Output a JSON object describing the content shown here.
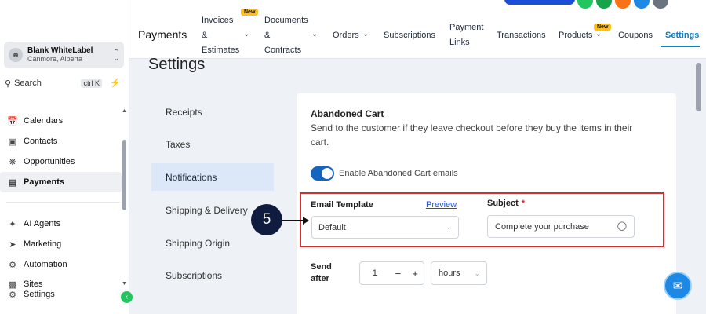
{
  "sidebar": {
    "account_name": "Blank WhiteLabel",
    "account_location": "Canmore, Alberta",
    "search_label": "Search",
    "search_shortcut": "ctrl K",
    "items_top": [
      {
        "label": "Calendars",
        "icon": "calendar-icon"
      },
      {
        "label": "Contacts",
        "icon": "contacts-icon"
      },
      {
        "label": "Opportunities",
        "icon": "opportunities-icon"
      },
      {
        "label": "Payments",
        "icon": "payments-icon",
        "active": true
      }
    ],
    "items_bottom": [
      {
        "label": "AI Agents",
        "icon": "ai-agents-icon"
      },
      {
        "label": "Marketing",
        "icon": "marketing-icon"
      },
      {
        "label": "Automation",
        "icon": "automation-icon"
      },
      {
        "label": "Sites",
        "icon": "sites-icon"
      },
      {
        "label": "Settings",
        "icon": "settings-icon"
      }
    ]
  },
  "topbar": {
    "title": "Payments",
    "tabs": [
      {
        "line1": "Invoices",
        "line2": "&",
        "line3": "Estimates",
        "badge": "New"
      },
      {
        "line1": "Documents",
        "line2": "&",
        "line3": "Contracts"
      },
      {
        "label": "Orders"
      },
      {
        "label": "Subscriptions"
      },
      {
        "line1": "Payment",
        "line2": "Links"
      },
      {
        "label": "Transactions"
      },
      {
        "label": "Products",
        "badge": "New"
      },
      {
        "label": "Coupons"
      },
      {
        "label": "Settings",
        "active": true
      }
    ]
  },
  "main": {
    "heading": "Settings",
    "menu": [
      "Receipts",
      "Taxes",
      "Notifications",
      "Shipping & Delivery",
      "Shipping Origin",
      "Subscriptions"
    ],
    "active_menu": "Notifications",
    "card": {
      "title": "Abandoned Cart",
      "description": "Send to the customer if they leave checkout before they buy the items in their cart.",
      "toggle_label": "Enable Abandoned Cart emails",
      "toggle_on": true,
      "email_template_label": "Email Template",
      "preview_label": "Preview",
      "email_template_value": "Default",
      "subject_label": "Subject",
      "subject_required": "*",
      "subject_value": "Complete your purchase",
      "send_after_line1": "Send",
      "send_after_line2": "after",
      "send_after_value": "1",
      "send_after_unit": "hours"
    }
  },
  "annotation": {
    "step_number": "5",
    "highlight_color": "#d32f2f",
    "circle_color": "#0f1c3f"
  },
  "colors": {
    "accent": "#0e7fbf",
    "toggle": "#1565c0",
    "badge": "#fbbf24"
  }
}
